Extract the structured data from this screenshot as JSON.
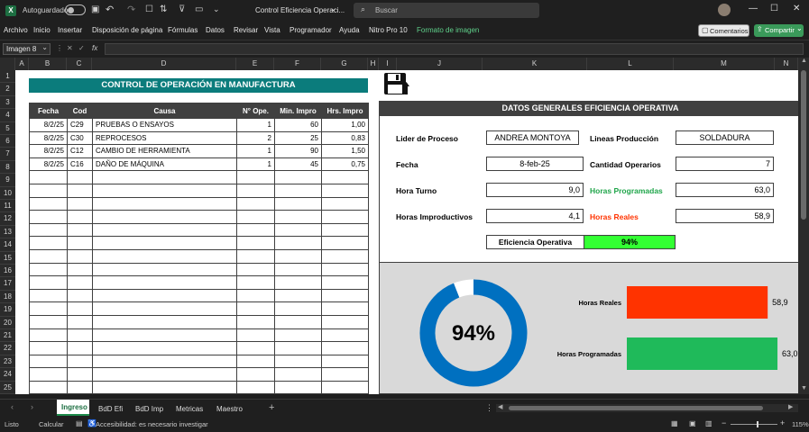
{
  "titlebar": {
    "autosave_label": "Autoguardado",
    "doc_title": "Control Eficiencia Operaci...",
    "search_placeholder": "Buscar"
  },
  "ribbon": {
    "menu": [
      "Archivo",
      "Inicio",
      "Insertar",
      "Disposición de página",
      "Fórmulas",
      "Datos",
      "Revisar",
      "Vista",
      "Programador",
      "Ayuda",
      "Nitro Pro 10",
      "Formato de imagen"
    ],
    "comments_label": "Comentarios",
    "share_label": "Compartir"
  },
  "formulabar": {
    "name_box": "Imagen 8",
    "fx": "fx"
  },
  "columns": [
    "A",
    "B",
    "C",
    "D",
    "E",
    "F",
    "G",
    "H",
    "I",
    "J",
    "K",
    "L",
    "M",
    "N"
  ],
  "rows": [
    "1",
    "2",
    "3",
    "4",
    "5",
    "6",
    "7",
    "8",
    "9",
    "10",
    "11",
    "12",
    "13",
    "14",
    "15",
    "16",
    "17",
    "18",
    "19",
    "20",
    "21",
    "22",
    "23",
    "24",
    "25"
  ],
  "left_table": {
    "title": "CONTROL DE OPERACIÓN EN MANUFACTURA",
    "headers": [
      "Fecha",
      "Cod",
      "Causa",
      "N° Ope.",
      "Min. Impro",
      "Hrs. Impro"
    ],
    "rows": [
      [
        "8/2/25",
        "C29",
        "PRUEBAS O ENSAYOS",
        "1",
        "60",
        "1,00"
      ],
      [
        "8/2/25",
        "C30",
        "REPROCESOS",
        "2",
        "25",
        "0,83"
      ],
      [
        "8/2/25",
        "C12",
        "CAMBIO DE HERRAMIENTA",
        "1",
        "90",
        "1,50"
      ],
      [
        "8/2/25",
        "C16",
        "DAÑO DE MÁQUINA",
        "1",
        "45",
        "0,75"
      ]
    ]
  },
  "panel": {
    "title": "DATOS GENERALES EFICIENCIA OPERATIVA",
    "lider_label": "Lider de Proceso",
    "lider_value": "ANDREA MONTOYA",
    "lineas_label": "Lineas Producción",
    "lineas_value": "SOLDADURA",
    "fecha_label": "Fecha",
    "fecha_value": "8-feb-25",
    "cantidad_label": "Cantidad Operarios",
    "cantidad_value": "7",
    "hora_turno_label": "Hora Turno",
    "hora_turno_value": "9,0",
    "horas_prog_label": "Horas Programadas",
    "horas_prog_value": "63,0",
    "horas_impro_label": "Horas Improductivos",
    "horas_impro_value": "4,1",
    "horas_reales_label": "Horas Reales",
    "horas_reales_value": "58,9",
    "eficiencia_label": "Eficiencia Operativa",
    "eficiencia_value": "94%"
  },
  "chart_data": [
    {
      "type": "pie",
      "values": [
        94,
        6
      ],
      "center_label": "94%",
      "colors": [
        "#0070c0",
        "#ffffff"
      ]
    },
    {
      "type": "bar",
      "orientation": "horizontal",
      "categories": [
        "Horas Reales",
        "Horas Programadas"
      ],
      "values": [
        58.9,
        63.0
      ],
      "data_labels": [
        "58,9",
        "63,0"
      ],
      "colors": [
        "#ff3300",
        "#1fba5a"
      ]
    }
  ],
  "tabs": [
    "Ingreso",
    "BdD Efi",
    "BdD Imp",
    "Metricas",
    "Maestro"
  ],
  "status": {
    "ready": "Listo",
    "calc": "Calcular",
    "accessibility": "Accesibilidad: es necesario investigar",
    "zoom": "115%"
  },
  "colors": {
    "teal_header": "#0b7c7c",
    "dark_header": "#404040",
    "green_label": "#1fa54a",
    "red_label": "#ff3300",
    "efficiency_fill": "#33ff33",
    "gray_panel": "#d9d9d9"
  }
}
